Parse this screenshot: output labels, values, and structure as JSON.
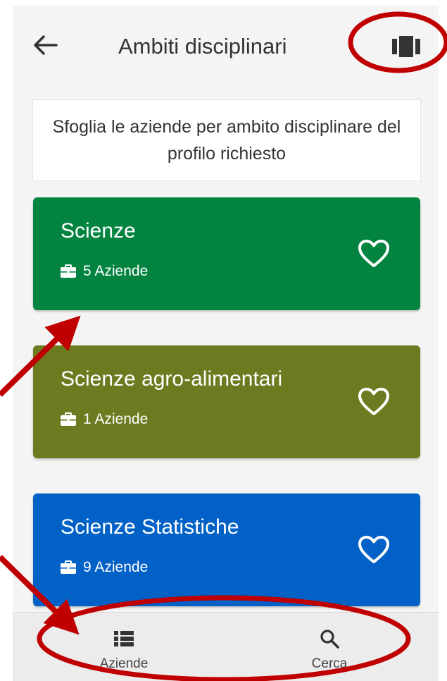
{
  "header": {
    "title": "Ambiti disciplinari",
    "back_icon": "arrow-left-icon",
    "layout_icon": "view-carousel-icon"
  },
  "intro": {
    "text": "Sfoglia le aziende per ambito disciplinare del profilo richiesto"
  },
  "cards": [
    {
      "title": "Scienze",
      "count": "5 Aziende",
      "color": "#028440",
      "icon": "briefcase-icon",
      "fav_icon": "heart-outline-icon"
    },
    {
      "title": "Scienze agro-alimentari",
      "count": "1 Aziende",
      "color": "#6c7b20",
      "icon": "briefcase-icon",
      "fav_icon": "heart-outline-icon"
    },
    {
      "title": "Scienze Statistiche",
      "count": "9 Aziende",
      "color": "#0161c6",
      "icon": "briefcase-icon",
      "fav_icon": "heart-outline-icon"
    }
  ],
  "bottom_nav": {
    "items": [
      {
        "label": "Aziende",
        "icon": "list-icon"
      },
      {
        "label": "Cerca",
        "icon": "search-icon"
      }
    ]
  },
  "annotations": {
    "color": "#c00000"
  }
}
